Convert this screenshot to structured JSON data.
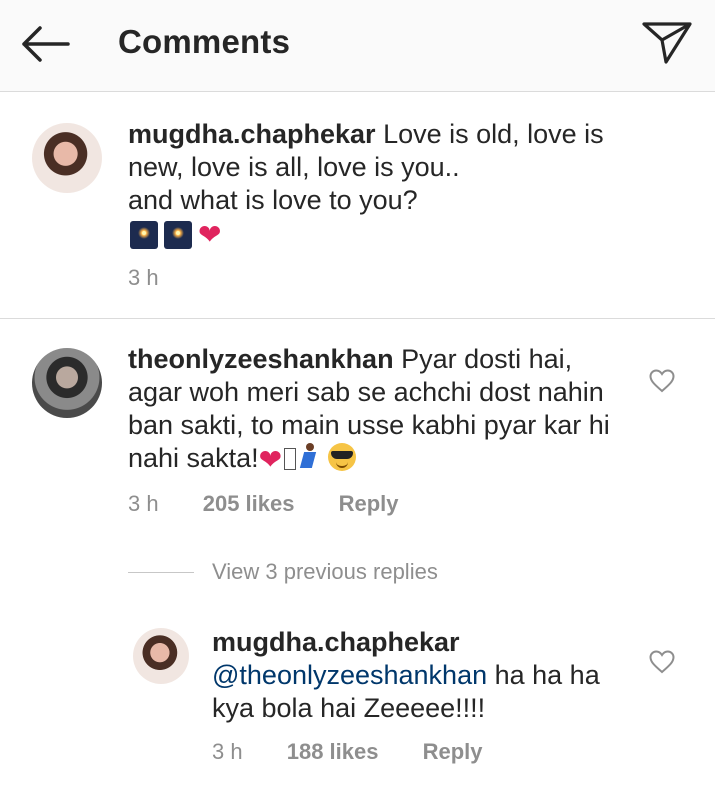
{
  "header": {
    "title": "Comments",
    "back_icon": "arrow-left-icon",
    "send_icon": "paper-plane-icon"
  },
  "caption": {
    "username": "mugdha.chaphekar",
    "line1": " Love is old, love is",
    "line2": "new, love is all, love is you..",
    "line3": "and what is love to you?",
    "emojis": [
      "fireworks",
      "fireworks",
      "heart"
    ],
    "time": "3 h"
  },
  "comment1": {
    "username": "theonlyzeeshankhan",
    "line1": " Pyar dosti hai,",
    "line2": "agar woh meri sab se achchi dost nahin",
    "line3": "ban sakti, to main usse kabhi pyar kar hi",
    "line4": "nahi sakta!",
    "time": "3 h",
    "likes": "205 likes",
    "reply": "Reply"
  },
  "view_replies": {
    "label": "View 3 previous replies"
  },
  "reply1": {
    "username": "mugdha.chaphekar",
    "mention": "@theonlyzeeshankhan",
    "line1_rest": " ha ha ha",
    "line2": "kya bola hai Zeeeee!!!!",
    "time": "3 h",
    "likes": "188 likes",
    "reply": "Reply"
  },
  "colors": {
    "text": "#262626",
    "secondary": "#8e8e8e",
    "mention": "#00376b",
    "divider": "#dbdbdb",
    "header_bg": "#fafafa",
    "heart": "#e0245e"
  }
}
